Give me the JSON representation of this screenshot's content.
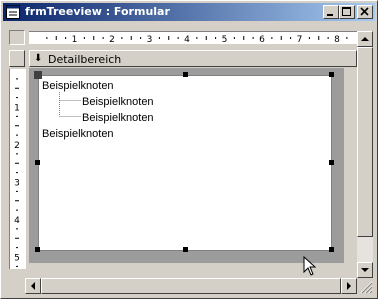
{
  "window": {
    "title": "frmTreeview : Formular",
    "buttons": {
      "minimize_icon": "minimize-icon",
      "maximize_icon": "maximize-icon",
      "close_icon": "close-icon"
    }
  },
  "ruler": {
    "horizontal_numbers": [
      "1",
      "2",
      "3",
      "4",
      "5",
      "6",
      "7",
      "8"
    ],
    "vertical_numbers": [
      "1",
      "2",
      "3",
      "4",
      "5"
    ]
  },
  "section": {
    "label": "Detailbereich",
    "arrow_icon": "arrow-down-icon"
  },
  "treeview": {
    "nodes": [
      {
        "label": "Beispielknoten",
        "level": 0
      },
      {
        "label": "Beispielknoten",
        "level": 1
      },
      {
        "label": "Beispielknoten",
        "level": 1
      },
      {
        "label": "Beispielknoten",
        "level": 0
      }
    ]
  },
  "colors": {
    "titlebar_start": "#0a246a",
    "titlebar_end": "#a6caf0",
    "detail_background": "#9c9c9c",
    "chrome": "#d4d0c8"
  }
}
